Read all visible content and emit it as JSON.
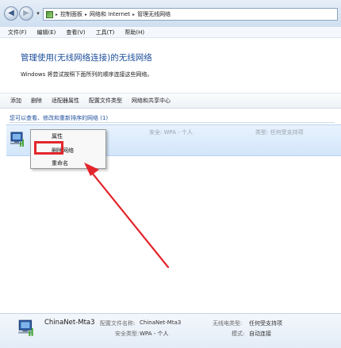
{
  "address_bar": {
    "crumbs": [
      "控制面板",
      "网络和 Internet",
      "管理无线网络"
    ]
  },
  "menu": [
    "文件(F)",
    "编辑(E)",
    "查看(V)",
    "工具(T)",
    "帮助(H)"
  ],
  "page": {
    "title": "管理使用(无线网络连接)的无线网络",
    "description": "Windows 将尝试按照下面所列的顺序连接这些网络。"
  },
  "toolbar": [
    "添加",
    "删除",
    "适配器属性",
    "配置文件类型",
    "网络和共享中心"
  ],
  "list_header": "您可以查看、修改和重新排序的网络 (1)",
  "network_row": {
    "name": "ChinaNet-Mta3",
    "security": "安全: WPA - 个人",
    "type": "类型: 任何受支持项"
  },
  "context_menu": {
    "items": [
      "属性",
      "删除网络",
      "重命名"
    ]
  },
  "details": {
    "name": "ChinaNet-Mta3",
    "profile_label": "配置文件名称:",
    "profile_value": "ChinaNet-Mta3",
    "security_label": "安全类型:",
    "security_value": "WPA - 个人",
    "radio_label": "无线电类型:",
    "radio_value": "任何受支持项",
    "mode_label": "模式:",
    "mode_value": "自动连接"
  },
  "colors": {
    "highlight": "#e3262c",
    "link_blue": "#1d4f9c"
  },
  "icons": [
    "back-arrow-icon",
    "forward-arrow-icon",
    "control-panel-icon",
    "wireless-network-icon",
    "chevron-right-icon"
  ]
}
